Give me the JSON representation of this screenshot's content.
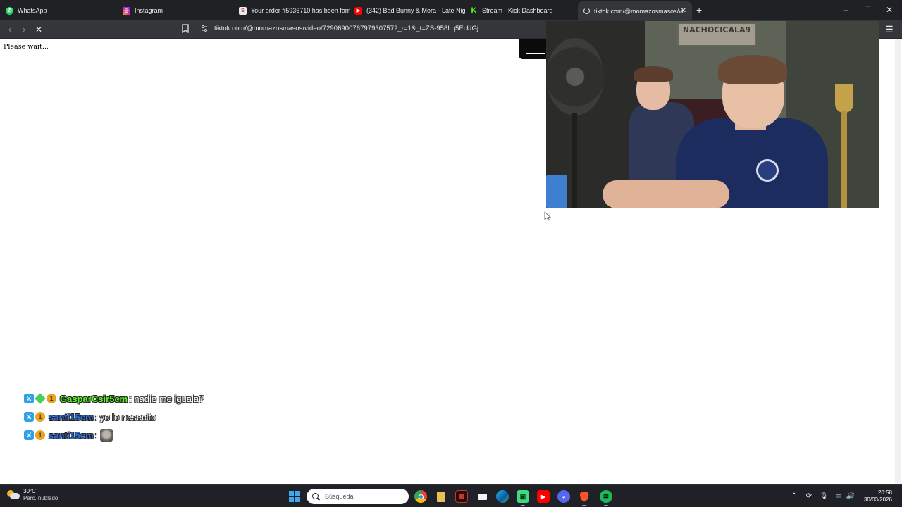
{
  "browser": {
    "tabs": [
      {
        "label": "WhatsApp",
        "icon": "whatsapp-icon",
        "color": "#25d366",
        "active": false
      },
      {
        "label": "Instagram",
        "icon": "instagram-icon",
        "color": "#d6249f",
        "active": false
      },
      {
        "label": "Your order #5936710 has been forme",
        "icon": "order-site-icon",
        "color": "#e8eaed",
        "active": false
      },
      {
        "label": "(342) Bad Bunny & Mora - Late Nigh",
        "icon": "youtube-icon",
        "color": "#ff0000",
        "active": false
      },
      {
        "label": "Stream - Kick Dashboard",
        "icon": "kick-icon",
        "color": "#53fc18",
        "active": false
      },
      {
        "label": "tiktok.com/@momazosmasos/vi",
        "icon": "loading-spinner-icon",
        "color": "#e8eaed",
        "active": true
      }
    ],
    "new_tab_symbol": "+",
    "url": "tiktok.com/@momazosmasos/video/7290690076797930757?_r=1&_t=ZS-958Lq5EcUGj",
    "page_text": "Please wait..."
  },
  "chat": {
    "messages": [
      {
        "user": "GasparCsir5cm",
        "user_color": "#53fc18",
        "badges": [
          "moderator-badge-icon",
          "vip-badge-icon",
          "subscriber-badge-icon"
        ],
        "text": ": nadie me iguala?"
      },
      {
        "user": "santi15cm",
        "user_color": "#2f6fd6",
        "badges": [
          "moderator-badge-icon",
          "subscriber-badge-icon"
        ],
        "text": ": yo lo nesecito"
      },
      {
        "user": "santi15cm",
        "user_color": "#2f6fd6",
        "badges": [
          "moderator-badge-icon",
          "subscriber-badge-icon"
        ],
        "text": ":",
        "emote": "cat-emote-icon"
      }
    ]
  },
  "webcam": {
    "sign_text": "NACHOCICALA9"
  },
  "taskbar": {
    "weather": {
      "temp": "30°C",
      "condition": "Parc. nublado"
    },
    "search_placeholder": "Búsqueda",
    "time": "20:58",
    "date": "30/03/2026",
    "pinned_apps": [
      "chrome-icon",
      "file-icon",
      "red-app-icon",
      "mail-icon",
      "edge-icon",
      "android-icon",
      "youtube-icon",
      "discord-icon",
      "brave-icon",
      "spotify-icon"
    ]
  }
}
